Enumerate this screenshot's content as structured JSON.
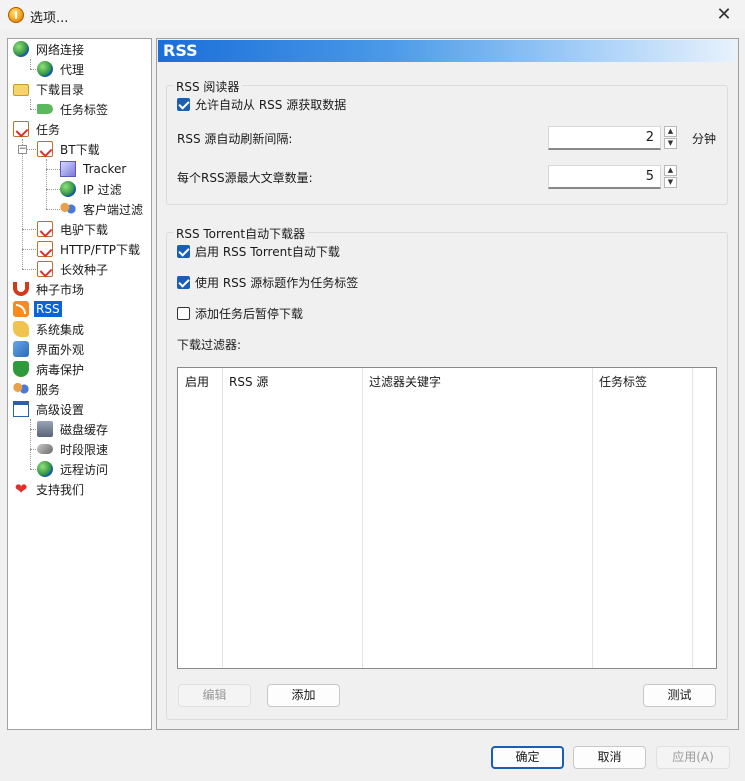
{
  "window": {
    "title": "选项...",
    "close_glyph": "✕"
  },
  "tree": {
    "items": [
      {
        "label": "网络连接",
        "icon": "globe-icon"
      },
      {
        "label": "代理",
        "icon": "globe-icon"
      },
      {
        "label": "下载目录",
        "icon": "folder-icon"
      },
      {
        "label": "任务标签",
        "icon": "tag-icon"
      },
      {
        "label": "任务",
        "icon": "clipboard-icon"
      },
      {
        "label": "BT下载",
        "icon": "clipboard-icon"
      },
      {
        "label": "Tracker",
        "icon": "cube-icon"
      },
      {
        "label": "IP 过滤",
        "icon": "globe-icon"
      },
      {
        "label": "客户端过滤",
        "icon": "network-icon"
      },
      {
        "label": "电驴下载",
        "icon": "clipboard-icon"
      },
      {
        "label": "HTTP/FTP下载",
        "icon": "clipboard-icon"
      },
      {
        "label": "长效种子",
        "icon": "clipboard-icon"
      },
      {
        "label": "种子市场",
        "icon": "magnet-icon"
      },
      {
        "label": "RSS",
        "icon": "rss-icon"
      },
      {
        "label": "系统集成",
        "icon": "hand-icon"
      },
      {
        "label": "界面外观",
        "icon": "brush-icon"
      },
      {
        "label": "病毒保护",
        "icon": "shield-icon"
      },
      {
        "label": "服务",
        "icon": "people-icon"
      },
      {
        "label": "高级设置",
        "icon": "window-icon"
      },
      {
        "label": "磁盘缓存",
        "icon": "disk-icon"
      },
      {
        "label": "时段限速",
        "icon": "pipe-icon"
      },
      {
        "label": "远程访问",
        "icon": "globe-icon"
      },
      {
        "label": "支持我们",
        "icon": "heart-icon"
      }
    ],
    "selected": "RSS"
  },
  "panel": {
    "header": "RSS",
    "reader": {
      "title": "RSS 阅读器",
      "auto_fetch_label": "允许自动从 RSS 源获取数据",
      "auto_fetch_checked": true,
      "refresh_label": "RSS 源自动刷新间隔:",
      "refresh_value": "2",
      "refresh_unit": "分钟",
      "max_articles_label": "每个RSS源最大文章数量:",
      "max_articles_value": "5"
    },
    "downloader": {
      "title": "RSS Torrent自动下载器",
      "enable_label": "启用 RSS Torrent自动下载",
      "enable_checked": true,
      "use_title_label": "使用 RSS 源标题作为任务标签",
      "use_title_checked": true,
      "pause_label": "添加任务后暂停下载",
      "pause_checked": false,
      "filters_label": "下载过滤器:",
      "columns": [
        "启用",
        "RSS 源",
        "过滤器关键字",
        "任务标签"
      ],
      "edit_button": "编辑",
      "add_button": "添加",
      "test_button": "测试"
    }
  },
  "footer": {
    "ok_button": "确定",
    "cancel_button": "取消",
    "apply_button": "应用(A)"
  },
  "spin_up": "▲",
  "spin_down": "▼",
  "expander_minus": "−"
}
